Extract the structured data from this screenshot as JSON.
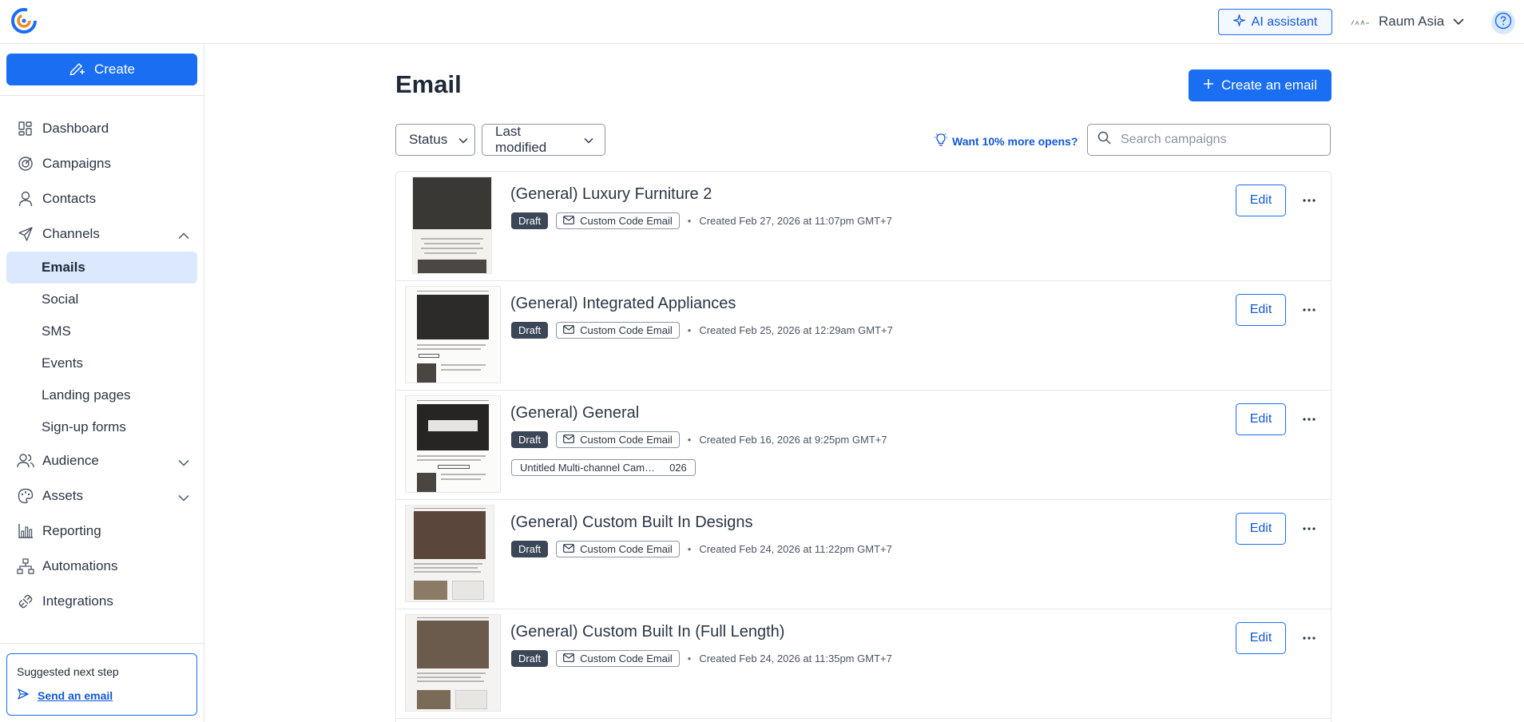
{
  "app": {
    "account_name": "Raum Asia"
  },
  "header": {
    "ai_label": "AI assistant"
  },
  "sidebar": {
    "create_label": "Create",
    "items": [
      {
        "label": "Dashboard",
        "icon": "dashboard-icon"
      },
      {
        "label": "Campaigns",
        "icon": "target-icon"
      },
      {
        "label": "Contacts",
        "icon": "person-icon"
      },
      {
        "label": "Channels",
        "icon": "send-icon",
        "expanded": true
      },
      {
        "label": "Audience",
        "icon": "group-icon"
      },
      {
        "label": "Assets",
        "icon": "palette-icon"
      },
      {
        "label": "Reporting",
        "icon": "chart-icon"
      },
      {
        "label": "Automations",
        "icon": "flow-icon"
      },
      {
        "label": "Integrations",
        "icon": "plug-icon"
      }
    ],
    "channels": [
      "Emails",
      "Social",
      "SMS",
      "Events",
      "Landing pages",
      "Sign-up forms"
    ],
    "suggest": {
      "title": "Suggested next step",
      "link": "Send an email"
    }
  },
  "main": {
    "title": "Email",
    "create_email_label": "Create an email",
    "filters": {
      "status": "Status",
      "sort": "Last modified"
    },
    "tip": "Want 10% more opens?",
    "search": {
      "placeholder": "Search campaigns",
      "value": ""
    },
    "edit_label": "Edit",
    "emails": [
      {
        "title": "(General) Luxury Furniture 2",
        "status": "Draft",
        "type": "Custom Code Email",
        "created": "Created Feb 27, 2026 at 11:07pm GMT+7"
      },
      {
        "title": "(General) Integrated Appliances",
        "status": "Draft",
        "type": "Custom Code Email",
        "created": "Created Feb 25, 2026 at 12:29am GMT+7"
      },
      {
        "title": "(General) General",
        "status": "Draft",
        "type": "Custom Code Email",
        "created": "Created Feb 16, 2026 at 9:25pm GMT+7",
        "campaign": "Untitled Multi-channel Cam…",
        "campaign_suffix": "026"
      },
      {
        "title": "(General) Custom Built In Designs",
        "status": "Draft",
        "type": "Custom Code Email",
        "created": "Created Feb 24, 2026 at 11:22pm GMT+7"
      },
      {
        "title": "(General) Custom Built In (Full Length)",
        "status": "Draft",
        "type": "Custom Code Email",
        "created": "Created Feb 24, 2026 at 11:35pm GMT+7"
      }
    ]
  }
}
